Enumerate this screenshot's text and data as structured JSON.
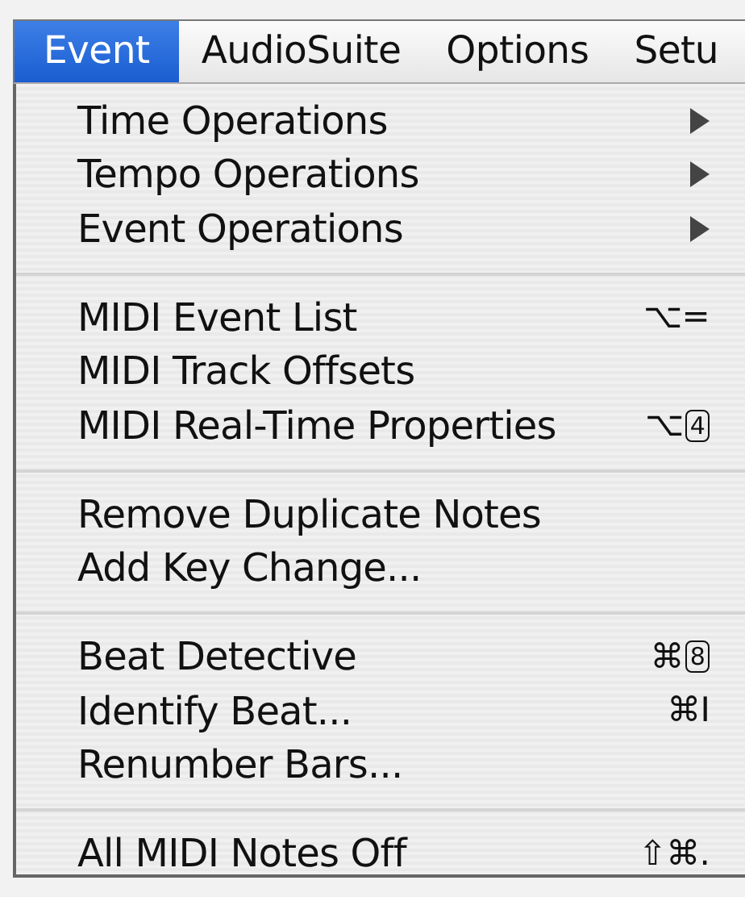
{
  "menu_bar": [
    {
      "label": "Event",
      "selected": true
    },
    {
      "label": "AudioSuite",
      "selected": false
    },
    {
      "label": "Options",
      "selected": false
    },
    {
      "label": "Setu",
      "selected": false
    }
  ],
  "menu": {
    "groups": [
      [
        {
          "label": "Time Operations",
          "submenu": true
        },
        {
          "label": "Tempo Operations",
          "submenu": true
        },
        {
          "label": "Event Operations",
          "submenu": true
        }
      ],
      [
        {
          "label": "MIDI Event List",
          "shortcut": {
            "modifiers": "⌥",
            "key": "=",
            "keypad": false
          }
        },
        {
          "label": "MIDI Track Offsets"
        },
        {
          "label": "MIDI Real-Time Properties",
          "shortcut": {
            "modifiers": "⌥",
            "key": "4",
            "keypad": true
          }
        }
      ],
      [
        {
          "label": "Remove Duplicate Notes"
        },
        {
          "label": "Add Key Change..."
        }
      ],
      [
        {
          "label": "Beat Detective",
          "shortcut": {
            "modifiers": "⌘",
            "key": "8",
            "keypad": true
          }
        },
        {
          "label": "Identify Beat...",
          "shortcut": {
            "modifiers": "⌘",
            "key": "I",
            "keypad": false
          }
        },
        {
          "label": "Renumber Bars..."
        }
      ],
      [
        {
          "label": "All MIDI Notes Off",
          "shortcut": {
            "modifiers": "⇧⌘",
            "key": ".",
            "keypad": false
          }
        }
      ]
    ]
  }
}
